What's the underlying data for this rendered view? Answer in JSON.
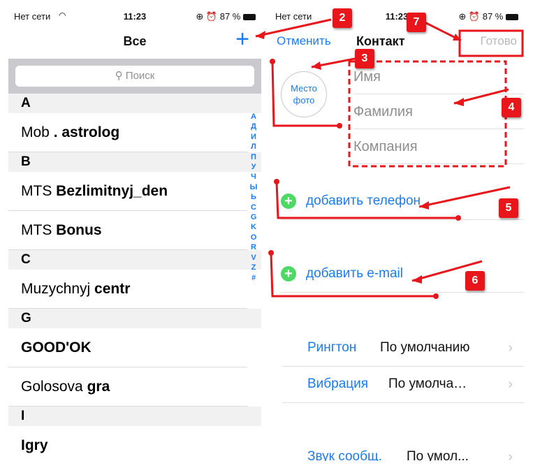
{
  "left": {
    "status": {
      "carrier": "Нет сети",
      "time": "11:23",
      "battery": "87 %"
    },
    "nav_title": "Все",
    "add_icon": "plus-icon",
    "search_placeholder": "Поиск",
    "sections": [
      {
        "letter": "A",
        "rows": [
          {
            "pre": "Mob ",
            "bold": ". astrolog"
          }
        ]
      },
      {
        "letter": "B",
        "rows": [
          {
            "pre": "MTS ",
            "bold": "Bezlimitnyj_den"
          },
          {
            "pre": "MTS ",
            "bold": "Bonus"
          }
        ]
      },
      {
        "letter": "C",
        "rows": [
          {
            "pre": "Muzychnyj ",
            "bold": "centr"
          }
        ]
      },
      {
        "letter": "G",
        "rows": [
          {
            "pre": "",
            "bold": "GOOD'OK"
          },
          {
            "pre": "Golosova ",
            "bold": "gra"
          }
        ]
      },
      {
        "letter": "I",
        "rows": [
          {
            "pre": "",
            "bold": "Igry"
          }
        ]
      }
    ],
    "index": [
      "А",
      "Д",
      "И",
      "Л",
      "П",
      "У",
      "Ч",
      "Ы",
      "Ь",
      "С",
      "G",
      "K",
      "O",
      "R",
      "V",
      "Z",
      "#"
    ]
  },
  "right": {
    "status": {
      "carrier": "Нет сети",
      "time": "11:23",
      "battery": "87 %"
    },
    "cancel": "Отменить",
    "title": "Контакт",
    "done": "Готово",
    "photo_line1": "Место",
    "photo_line2": "фото",
    "first_name": "Имя",
    "last_name": "Фамилия",
    "company": "Компания",
    "add_phone": "добавить телефон",
    "add_email": "добавить e-mail",
    "ringtone_label": "Рингтон",
    "ringtone_value": "По умолчанию",
    "vibration_label": "Вибрация",
    "vibration_value": "По умолча…",
    "sound_label": "Звук сообщ.",
    "sound_value": "По умол..."
  },
  "badges": [
    "2",
    "3",
    "4",
    "5",
    "6",
    "7"
  ],
  "colors": {
    "accent": "#1a7cf0",
    "annotation": "#e8161a",
    "add_green": "#4cd964"
  }
}
